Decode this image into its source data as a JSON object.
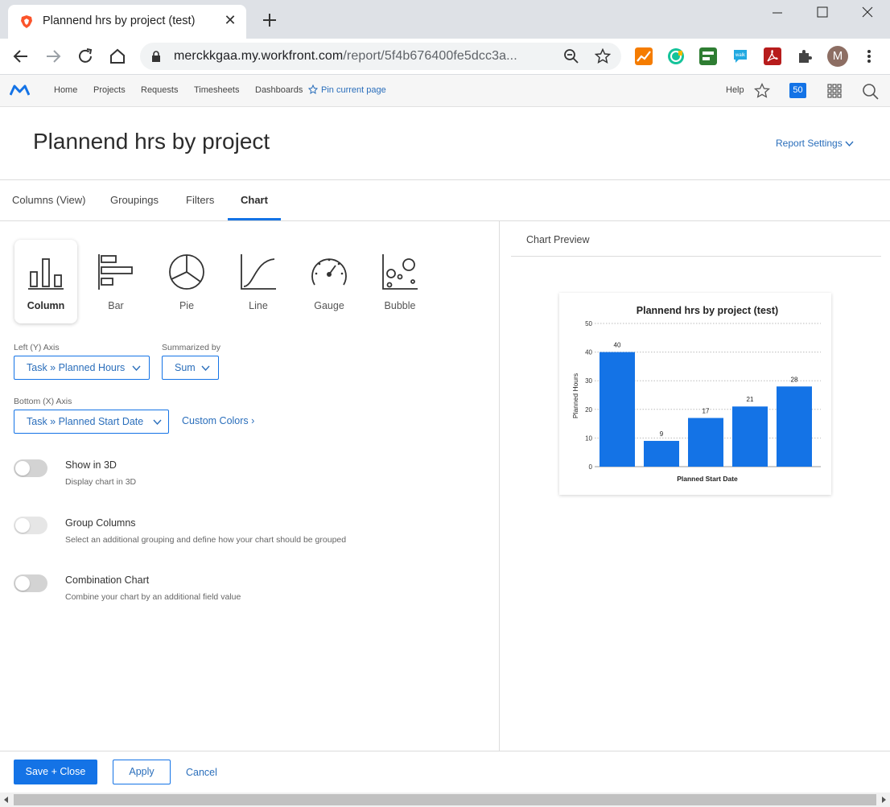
{
  "browser": {
    "tab_title": "Plannend hrs by project (test)",
    "tab_close": "✕",
    "url_host": "merckkgaa.my.workfront.com",
    "url_path": "/report/5f4b676400fe5dcc3a...",
    "profile_initial": "M"
  },
  "app": {
    "nav": [
      "Home",
      "Projects",
      "Requests",
      "Timesheets",
      "Dashboards"
    ],
    "pin_label": "Pin current page",
    "help_label": "Help",
    "notification_count": "50"
  },
  "page": {
    "title": "Plannend hrs by project",
    "report_settings": "Report Settings"
  },
  "tabs": [
    "Columns (View)",
    "Groupings",
    "Filters",
    "Chart"
  ],
  "chart_types": [
    "Column",
    "Bar",
    "Pie",
    "Line",
    "Gauge",
    "Bubble"
  ],
  "fields": {
    "y_axis_label": "Left (Y) Axis",
    "y_axis_value": "Task » Planned Hours",
    "summarized_label": "Summarized by",
    "summarized_value": "Sum",
    "x_axis_label": "Bottom (X) Axis",
    "x_axis_value": "Task » Planned Start Date",
    "custom_colors": "Custom Colors ›"
  },
  "options": [
    {
      "title": "Show in 3D",
      "desc": "Display chart in 3D"
    },
    {
      "title": "Group Columns",
      "desc": "Select an additional grouping and define how your chart should be grouped"
    },
    {
      "title": "Combination Chart",
      "desc": "Combine your chart by an additional field value"
    }
  ],
  "preview_label": "Chart Preview",
  "footer": {
    "save": "Save + Close",
    "apply": "Apply",
    "cancel": "Cancel"
  },
  "colors": {
    "accent": "#1473e6",
    "bar": "#1473e6"
  },
  "chart_data": {
    "type": "bar",
    "title": "Plannend hrs by project (test)",
    "xlabel": "Planned Start Date",
    "ylabel": "Planned Hours",
    "categories": [
      "",
      "",
      "",
      "",
      ""
    ],
    "values": [
      40,
      9,
      17,
      21,
      28
    ],
    "ylim": [
      0,
      50
    ],
    "yticks": [
      0,
      10,
      20,
      30,
      40,
      50
    ],
    "grid": true,
    "data_labels": true
  }
}
